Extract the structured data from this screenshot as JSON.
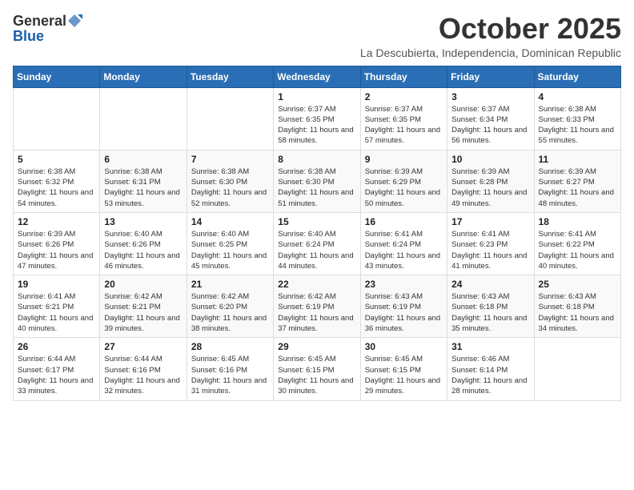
{
  "logo": {
    "general": "General",
    "blue": "Blue"
  },
  "title": "October 2025",
  "subtitle": "La Descubierta, Independencia, Dominican Republic",
  "days_of_week": [
    "Sunday",
    "Monday",
    "Tuesday",
    "Wednesday",
    "Thursday",
    "Friday",
    "Saturday"
  ],
  "weeks": [
    [
      {
        "day": "",
        "info": ""
      },
      {
        "day": "",
        "info": ""
      },
      {
        "day": "",
        "info": ""
      },
      {
        "day": "1",
        "info": "Sunrise: 6:37 AM\nSunset: 6:35 PM\nDaylight: 11 hours and 58 minutes."
      },
      {
        "day": "2",
        "info": "Sunrise: 6:37 AM\nSunset: 6:35 PM\nDaylight: 11 hours and 57 minutes."
      },
      {
        "day": "3",
        "info": "Sunrise: 6:37 AM\nSunset: 6:34 PM\nDaylight: 11 hours and 56 minutes."
      },
      {
        "day": "4",
        "info": "Sunrise: 6:38 AM\nSunset: 6:33 PM\nDaylight: 11 hours and 55 minutes."
      }
    ],
    [
      {
        "day": "5",
        "info": "Sunrise: 6:38 AM\nSunset: 6:32 PM\nDaylight: 11 hours and 54 minutes."
      },
      {
        "day": "6",
        "info": "Sunrise: 6:38 AM\nSunset: 6:31 PM\nDaylight: 11 hours and 53 minutes."
      },
      {
        "day": "7",
        "info": "Sunrise: 6:38 AM\nSunset: 6:30 PM\nDaylight: 11 hours and 52 minutes."
      },
      {
        "day": "8",
        "info": "Sunrise: 6:38 AM\nSunset: 6:30 PM\nDaylight: 11 hours and 51 minutes."
      },
      {
        "day": "9",
        "info": "Sunrise: 6:39 AM\nSunset: 6:29 PM\nDaylight: 11 hours and 50 minutes."
      },
      {
        "day": "10",
        "info": "Sunrise: 6:39 AM\nSunset: 6:28 PM\nDaylight: 11 hours and 49 minutes."
      },
      {
        "day": "11",
        "info": "Sunrise: 6:39 AM\nSunset: 6:27 PM\nDaylight: 11 hours and 48 minutes."
      }
    ],
    [
      {
        "day": "12",
        "info": "Sunrise: 6:39 AM\nSunset: 6:26 PM\nDaylight: 11 hours and 47 minutes."
      },
      {
        "day": "13",
        "info": "Sunrise: 6:40 AM\nSunset: 6:26 PM\nDaylight: 11 hours and 46 minutes."
      },
      {
        "day": "14",
        "info": "Sunrise: 6:40 AM\nSunset: 6:25 PM\nDaylight: 11 hours and 45 minutes."
      },
      {
        "day": "15",
        "info": "Sunrise: 6:40 AM\nSunset: 6:24 PM\nDaylight: 11 hours and 44 minutes."
      },
      {
        "day": "16",
        "info": "Sunrise: 6:41 AM\nSunset: 6:24 PM\nDaylight: 11 hours and 43 minutes."
      },
      {
        "day": "17",
        "info": "Sunrise: 6:41 AM\nSunset: 6:23 PM\nDaylight: 11 hours and 41 minutes."
      },
      {
        "day": "18",
        "info": "Sunrise: 6:41 AM\nSunset: 6:22 PM\nDaylight: 11 hours and 40 minutes."
      }
    ],
    [
      {
        "day": "19",
        "info": "Sunrise: 6:41 AM\nSunset: 6:21 PM\nDaylight: 11 hours and 40 minutes."
      },
      {
        "day": "20",
        "info": "Sunrise: 6:42 AM\nSunset: 6:21 PM\nDaylight: 11 hours and 39 minutes."
      },
      {
        "day": "21",
        "info": "Sunrise: 6:42 AM\nSunset: 6:20 PM\nDaylight: 11 hours and 38 minutes."
      },
      {
        "day": "22",
        "info": "Sunrise: 6:42 AM\nSunset: 6:19 PM\nDaylight: 11 hours and 37 minutes."
      },
      {
        "day": "23",
        "info": "Sunrise: 6:43 AM\nSunset: 6:19 PM\nDaylight: 11 hours and 36 minutes."
      },
      {
        "day": "24",
        "info": "Sunrise: 6:43 AM\nSunset: 6:18 PM\nDaylight: 11 hours and 35 minutes."
      },
      {
        "day": "25",
        "info": "Sunrise: 6:43 AM\nSunset: 6:18 PM\nDaylight: 11 hours and 34 minutes."
      }
    ],
    [
      {
        "day": "26",
        "info": "Sunrise: 6:44 AM\nSunset: 6:17 PM\nDaylight: 11 hours and 33 minutes."
      },
      {
        "day": "27",
        "info": "Sunrise: 6:44 AM\nSunset: 6:16 PM\nDaylight: 11 hours and 32 minutes."
      },
      {
        "day": "28",
        "info": "Sunrise: 6:45 AM\nSunset: 6:16 PM\nDaylight: 11 hours and 31 minutes."
      },
      {
        "day": "29",
        "info": "Sunrise: 6:45 AM\nSunset: 6:15 PM\nDaylight: 11 hours and 30 minutes."
      },
      {
        "day": "30",
        "info": "Sunrise: 6:45 AM\nSunset: 6:15 PM\nDaylight: 11 hours and 29 minutes."
      },
      {
        "day": "31",
        "info": "Sunrise: 6:46 AM\nSunset: 6:14 PM\nDaylight: 11 hours and 28 minutes."
      },
      {
        "day": "",
        "info": ""
      }
    ]
  ]
}
